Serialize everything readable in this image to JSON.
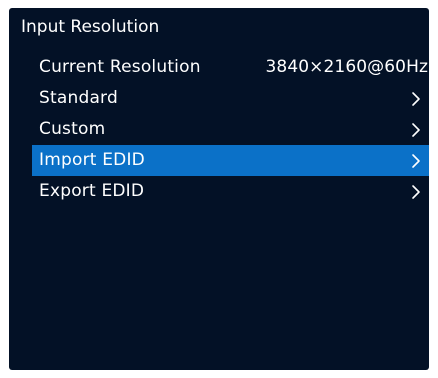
{
  "menu": {
    "title": "Input Resolution",
    "items": [
      {
        "label": "Current Resolution",
        "value": "3840×2160@60Hz",
        "has_submenu": false,
        "selected": false
      },
      {
        "label": "Standard",
        "arrow": ">",
        "has_submenu": true,
        "selected": false
      },
      {
        "label": "Custom",
        "arrow": ">",
        "has_submenu": true,
        "selected": false
      },
      {
        "label": "Import EDID",
        "arrow": ">",
        "has_submenu": true,
        "selected": true
      },
      {
        "label": "Export EDID",
        "arrow": ">",
        "has_submenu": true,
        "selected": false
      }
    ]
  },
  "colors": {
    "background": "#031126",
    "selection": "#0b71c8",
    "text": "#ffffff"
  },
  "icons": {
    "submenu_arrow": "chevron-right-icon"
  }
}
